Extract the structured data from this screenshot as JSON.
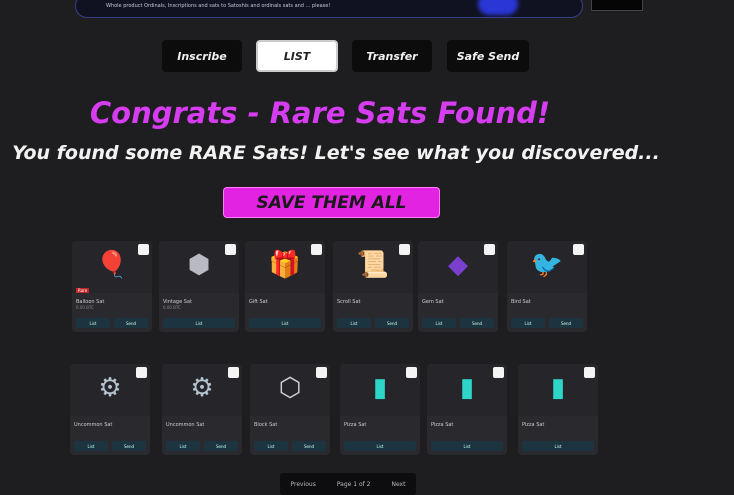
{
  "topbar": {
    "message": "Whole product Ordinals, Inscriptions and sats to Satoshis and ordinals sats and ... please!",
    "input_value": ""
  },
  "tabs": [
    {
      "label": "Inscribe",
      "active": false
    },
    {
      "label": "LIST",
      "active": true
    },
    {
      "label": "Transfer",
      "active": false
    },
    {
      "label": "Safe Send",
      "active": false
    }
  ],
  "heading": {
    "title": "Congrats - Rare Sats Found!",
    "subtitle": "You found some RARE Sats! Let's see what you discovered..."
  },
  "save_button": {
    "label": "SAVE THEM ALL"
  },
  "cards_row1": [
    {
      "art": "🎈",
      "color": "#e043d6",
      "tag": "Rare",
      "name": "Balloon Sat",
      "sub": "0.00 BTC",
      "a1": "List",
      "a2": "Send"
    },
    {
      "art": "⬢",
      "color": "#b9b9c3",
      "tag": "",
      "name": "Vintage Sat",
      "sub": "0.00 BTC",
      "a1": "List",
      "a2": ""
    },
    {
      "art": "🎁",
      "color": "#e06aa0",
      "tag": "",
      "name": "Gift Sat",
      "sub": "",
      "a1": "List",
      "a2": ""
    },
    {
      "art": "📜",
      "color": "#e3c88a",
      "tag": "",
      "name": "Scroll Sat",
      "sub": "",
      "a1": "List",
      "a2": "Send"
    },
    {
      "art": "◆",
      "color": "#7b3fd0",
      "tag": "",
      "name": "Gem Sat",
      "sub": "",
      "a1": "List",
      "a2": "Send"
    },
    {
      "art": "🐦",
      "color": "#4fb6e0",
      "tag": "",
      "name": "Bird Sat",
      "sub": "",
      "a1": "List",
      "a2": "Send"
    }
  ],
  "cards_row2": [
    {
      "art": "⚙",
      "color": "#b5c3cf",
      "tag": "",
      "name": "Uncommon Sat",
      "sub": "",
      "a1": "List",
      "a2": "Send"
    },
    {
      "art": "⚙",
      "color": "#b5c3cf",
      "tag": "",
      "name": "Uncommon Sat",
      "sub": "",
      "a1": "List",
      "a2": "Send"
    },
    {
      "art": "⬡",
      "color": "#d0d0d0",
      "tag": "",
      "name": "Block Sat",
      "sub": "",
      "a1": "List",
      "a2": "Send"
    },
    {
      "art": "▮",
      "color": "#2ed6c8",
      "tag": "",
      "name": "Pizza Sat",
      "sub": "",
      "a1": "List",
      "a2": ""
    },
    {
      "art": "▮",
      "color": "#2ed6c8",
      "tag": "",
      "name": "Pizza Sat",
      "sub": "",
      "a1": "List",
      "a2": ""
    },
    {
      "art": "▮",
      "color": "#2ed6c8",
      "tag": "",
      "name": "Pizza Sat",
      "sub": "",
      "a1": "List",
      "a2": ""
    }
  ],
  "pager": {
    "prev": "Previous",
    "page": "Page 1 of 2",
    "next": "Next"
  }
}
